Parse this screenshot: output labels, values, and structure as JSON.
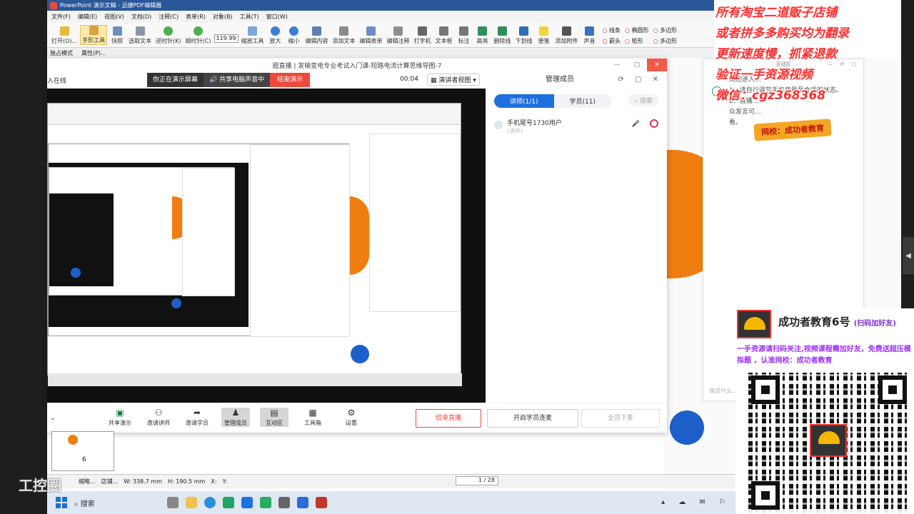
{
  "app": {
    "titlebar": "PowerPoint 演示文稿 - 迅捷PDF编辑器",
    "menus": [
      "文件(F)",
      "编辑(E)",
      "视图(V)",
      "文档(D)",
      "注释(C)",
      "表单(R)",
      "对象(B)",
      "工具(T)",
      "窗口(W)"
    ],
    "ribbon": [
      "打开(O)...",
      "手形工具",
      "快照",
      "选取文本",
      "逆时针(K)",
      "顺时针(C)",
      "缩放工具",
      "放大",
      "缩小",
      "编辑内容",
      "添加文本",
      "编辑表单",
      "编辑注释",
      "打字机",
      "文本框",
      "标注",
      "高亮",
      "删除线",
      "下划线",
      "便笺",
      "添加附件",
      "声音"
    ],
    "zoom": "119.99",
    "shapes": [
      "线条",
      "箭头",
      "椭圆形",
      "矩形",
      "多边形",
      "多边形"
    ],
    "optionbar": [
      "独占模式",
      "属性(P)..."
    ]
  },
  "live": {
    "window_title": "题直播 | 发输变电专业考试入门课-短路电流计算思维导图-7",
    "side_label": "入在线",
    "presenting": "你正在演示屏幕",
    "share_audio": "共享电脑声音中",
    "end_present": "结束演示",
    "timer": "00:04",
    "view_mode": "演讲者视图",
    "members_title": "管理成员",
    "tab_teacher": "讲师(1/1)",
    "tab_student": "学员(11)",
    "search": "搜索",
    "member_name": "手机尾号1730用户",
    "member_role": "(讲师)",
    "toolbar": [
      {
        "label": "共享演示",
        "icon": "chart-icon"
      },
      {
        "label": "邀请讲师",
        "icon": "add-user-icon"
      },
      {
        "label": "邀请学员",
        "icon": "share-icon"
      },
      {
        "label": "管理成员",
        "icon": "user-icon"
      },
      {
        "label": "互动区",
        "icon": "chat-icon"
      },
      {
        "label": "工具箱",
        "icon": "grid-icon"
      },
      {
        "label": "设置",
        "icon": "gear-icon"
      }
    ],
    "end_live": "结束直播",
    "link_mic": "开启学员连麦",
    "mute_all": "全员下麦"
  },
  "interact": {
    "title": "互动区",
    "intro": "欢迎进入...",
    "line1": "1、请自行调节手机音量至合适的状态。",
    "line2": "2、直播...",
    "line2b": "众发言可...",
    "line3": "看。",
    "input_placeholder": "说点什么..."
  },
  "status": {
    "thumb_num": "6",
    "items": [
      "缩略...",
      "店铺...",
      "W: 338.7 mm",
      "H: 190.5 mm",
      "X:",
      "Y:"
    ],
    "page": "1 / 28"
  },
  "taskbar": {
    "search": "搜索"
  },
  "watermark": "工控圈",
  "promo": {
    "lines": [
      "所有淘宝二道贩子店铺",
      "或者拼多多购买均为翻录",
      "更新速度慢，抓紧退款",
      "验证一手资源视频",
      "微信：cgz368368"
    ],
    "badge": "网校：成功者教育",
    "card_title": "成功者教育6号",
    "card_tag": "(扫码加好友)",
    "card_desc": "一手资源请扫码关注,视频课程需加好友，免费送超压模拟题 ，认准网校：成功者教育",
    "logo_text": "6号"
  }
}
